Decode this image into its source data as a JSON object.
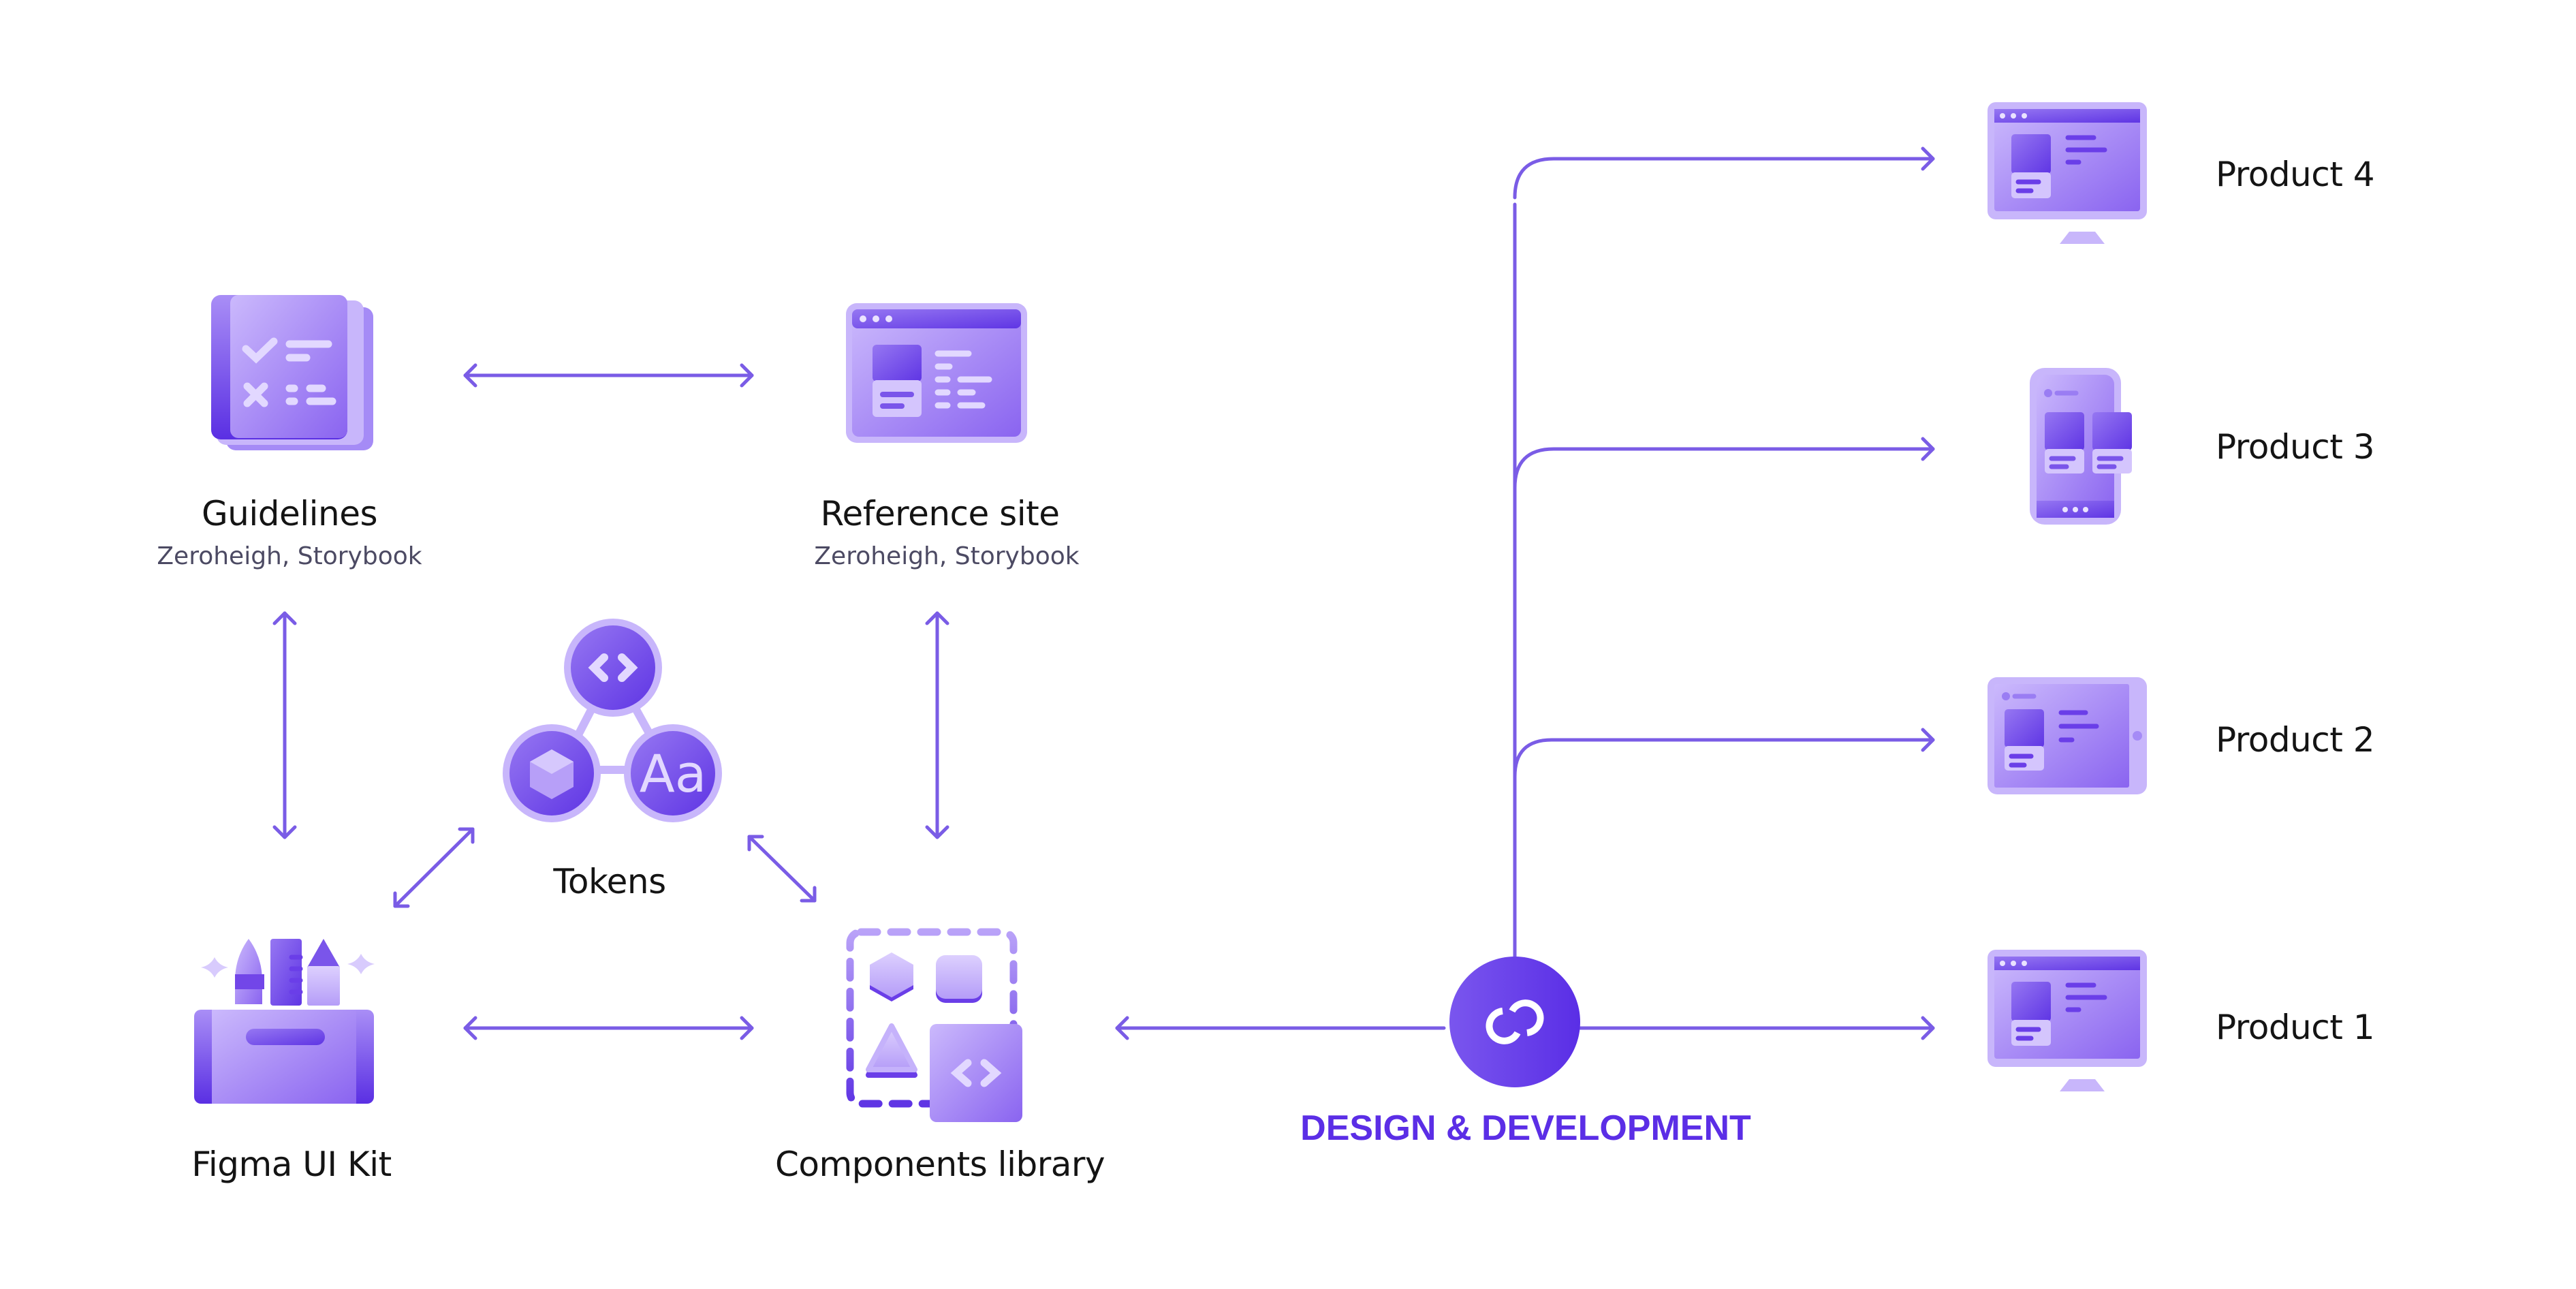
{
  "colors": {
    "accent": "#7a5ce6",
    "hub": "#5b2ee6",
    "icon_light": "#c9b6fb",
    "icon_mid": "#a78bf7",
    "icon_dark": "#6a3ee8",
    "text": "#141414",
    "subtext": "#4c4a63"
  },
  "nodes": {
    "guidelines": {
      "title": "Guidelines",
      "subtitle": "Zeroheigh, Storybook",
      "icon": "book-checklist-icon"
    },
    "reference_site": {
      "title": "Reference site",
      "subtitle": "Zeroheigh, Storybook",
      "icon": "browser-window-icon"
    },
    "tokens": {
      "title": "Tokens",
      "icon": "tokens-network-icon"
    },
    "figma_ui_kit": {
      "title": "Figma UI Kit",
      "icon": "toolbox-icon"
    },
    "components_library": {
      "title": "Components library",
      "icon": "components-icon"
    }
  },
  "hub": {
    "label": "DESIGN & DEVELOPMENT",
    "icon": "link-icon"
  },
  "products": [
    {
      "label": "Product 4",
      "device": "desktop"
    },
    {
      "label": "Product 3",
      "device": "mobile"
    },
    {
      "label": "Product 2",
      "device": "tablet"
    },
    {
      "label": "Product 1",
      "device": "desktop"
    }
  ],
  "connections": [
    {
      "from": "Guidelines",
      "to": "Reference site",
      "type": "bidirectional"
    },
    {
      "from": "Guidelines",
      "to": "Figma UI Kit",
      "type": "bidirectional"
    },
    {
      "from": "Reference site",
      "to": "Components library",
      "type": "bidirectional"
    },
    {
      "from": "Figma UI Kit",
      "to": "Components library",
      "type": "bidirectional"
    },
    {
      "from": "Figma UI Kit",
      "to": "Tokens",
      "type": "bidirectional"
    },
    {
      "from": "Tokens",
      "to": "Components library",
      "type": "bidirectional"
    },
    {
      "from": "DESIGN & DEVELOPMENT",
      "to": "Components library",
      "type": "directed"
    },
    {
      "from": "DESIGN & DEVELOPMENT",
      "to": "Product 1",
      "type": "directed"
    },
    {
      "from": "DESIGN & DEVELOPMENT",
      "to": "Product 2",
      "type": "directed"
    },
    {
      "from": "DESIGN & DEVELOPMENT",
      "to": "Product 3",
      "type": "directed"
    },
    {
      "from": "DESIGN & DEVELOPMENT",
      "to": "Product 4",
      "type": "directed"
    }
  ]
}
